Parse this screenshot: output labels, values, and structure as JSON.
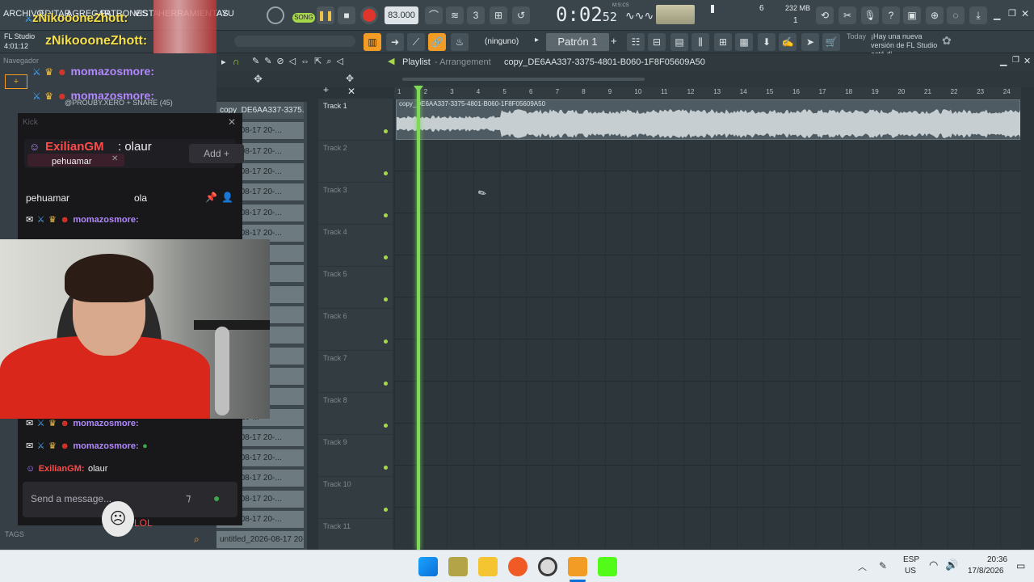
{
  "menu": [
    "ARCHIVO",
    "EDITAR",
    "AGREGAR",
    "PATRONES",
    "VISTA",
    "HERRAMIENTAS",
    "AYU"
  ],
  "app": {
    "name": "FL Studio",
    "elapsed": "4:01:12"
  },
  "overlay_user": "zNikoooneZhott:",
  "transport": {
    "mode_label": "SONG",
    "tempo": "83.000",
    "time": "0:02",
    "time_ms": "52",
    "time_unit": "M:S:CS",
    "cpu_value": "6",
    "memory": "232 MB",
    "poly": "1"
  },
  "toolbar2": {
    "snap": "(ninguno)",
    "pattern": "Patrón 1",
    "news_label": "Today",
    "news_text": "¡Hay una nueva versión de FL Studio está di"
  },
  "browser": {
    "title": "Navegador",
    "item1": "@PROUBY.XERO + SNARE (45)"
  },
  "playlist": {
    "title": "Playlist",
    "subtitle": "Arrangement",
    "clip_name": "copy_DE6AA337-3375-4801-B060-1F8F05609A50",
    "clip_short": "copy_DE6AA337-3375...",
    "ruler": [
      "1",
      "2",
      "3",
      "4",
      "5",
      "6",
      "7",
      "8",
      "9",
      "10",
      "11",
      "12",
      "13",
      "14",
      "15",
      "16",
      "17",
      "18",
      "19",
      "20",
      "21",
      "22",
      "23",
      "24"
    ],
    "tracks": [
      "Track 1",
      "Track 2",
      "Track 3",
      "Track 4",
      "Track 5",
      "Track 6",
      "Track 7",
      "Track 8",
      "Track 9",
      "Track 10",
      "Track 11"
    ]
  },
  "cliplist": [
    "copy_DE6AA337-3375...",
    "2026-08-17 20-...",
    "2026-08-17 20-...",
    "2026-08-17 20-...",
    "2026-08-17 20-...",
    "2026-08-17 20-...",
    "2026-08-17 20-...",
    "-8-17 20-...",
    "-8-17 20-...",
    "-8-17 20-...",
    "-8-17 20-...",
    "-8-17 20-...",
    "-8-17 20-...",
    "-8-17 20-...",
    "-8-17 20-...",
    "-8-17 20-...",
    "2026-08-17 20-...",
    "2026-08-17 20-...",
    "2026-08-17 20-...",
    "2026-08-17 20-...",
    "2026-08-17 20-...",
    "untitled_2026-08-17 20-..."
  ],
  "chat": {
    "tab_label": "Kick",
    "featured_user": "ExilianGM",
    "featured_msg": ": olaur",
    "pinned_user": "pehuamar",
    "add_label": "Add",
    "reply_user": "pehuamar",
    "reply_msg": "ola",
    "spam_user": "momazosmore:",
    "last_user": "ExilianGM:",
    "last_msg": "olaur",
    "input_placeholder": "Send a message...",
    "tags_label": "TAGS",
    "lol": "LOL"
  },
  "taskbar": {
    "lang1": "ESP",
    "lang2": "US",
    "clock": "20:36",
    "date": "17/8/2026"
  },
  "colors": {
    "accent_green": "#7ed957",
    "record_red": "#e0352b",
    "fl_orange": "#f29b25",
    "kick_green": "#53fc18",
    "chat_red": "#ff4a4a"
  }
}
